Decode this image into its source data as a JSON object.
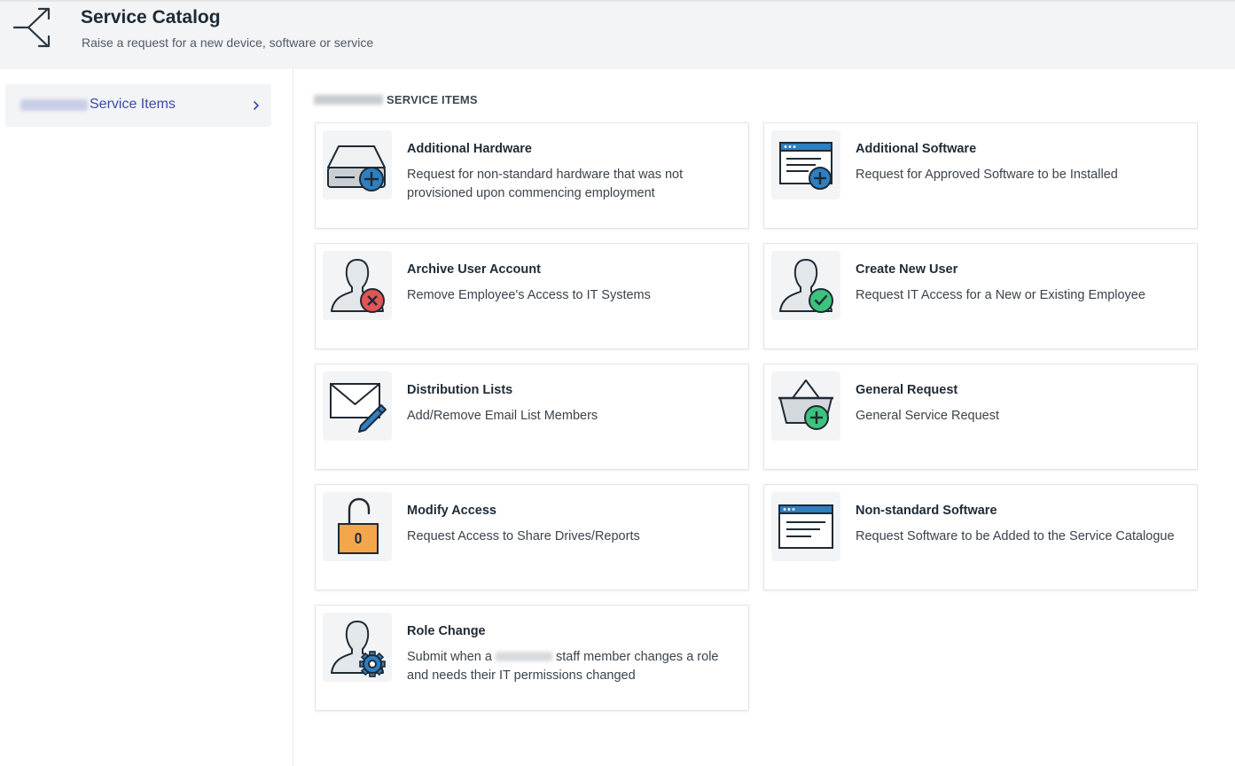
{
  "header": {
    "title": "Service Catalog",
    "subtitle": "Raise a request for a new device, software or service",
    "icon": "split-arrows-icon"
  },
  "sidebar": {
    "items": [
      {
        "label": "Service Items",
        "icon": "chevron-right-icon"
      }
    ]
  },
  "section": {
    "heading": "SERVICE ITEMS"
  },
  "cards": [
    {
      "title": "Additional Hardware",
      "description": "Request for non-standard hardware that was not provisioned upon commencing employment",
      "icon": "hardware-add-icon"
    },
    {
      "title": "Additional Software",
      "description": "Request for Approved Software to be Installed",
      "icon": "software-add-icon"
    },
    {
      "title": "Archive User Account",
      "description": "Remove Employee's Access to IT Systems",
      "icon": "user-remove-icon"
    },
    {
      "title": "Create New User",
      "description": "Request IT Access for a New or Existing Employee",
      "icon": "user-add-icon"
    },
    {
      "title": "Distribution Lists",
      "description": "Add/Remove Email List Members",
      "icon": "mail-edit-icon"
    },
    {
      "title": "General Request",
      "description": "General Service Request",
      "icon": "basket-add-icon"
    },
    {
      "title": "Modify Access",
      "description": "Request Access to Share Drives/Reports",
      "icon": "unlocked-padlock-icon"
    },
    {
      "title": "Non-standard Software",
      "description": "Request Software to be Added to the Service Catalogue",
      "icon": "software-window-icon"
    },
    {
      "title": "Role Change",
      "description_before": "Submit when a",
      "description_after": "staff member changes a role and needs their IT permissions changed",
      "icon": "user-settings-icon"
    }
  ],
  "colors": {
    "accent_blue": "#2f7fc1",
    "remove_red": "#e25555",
    "add_green": "#3cc47c",
    "lock_orange": "#f3a64c",
    "link_blue": "#3b4aa8"
  }
}
